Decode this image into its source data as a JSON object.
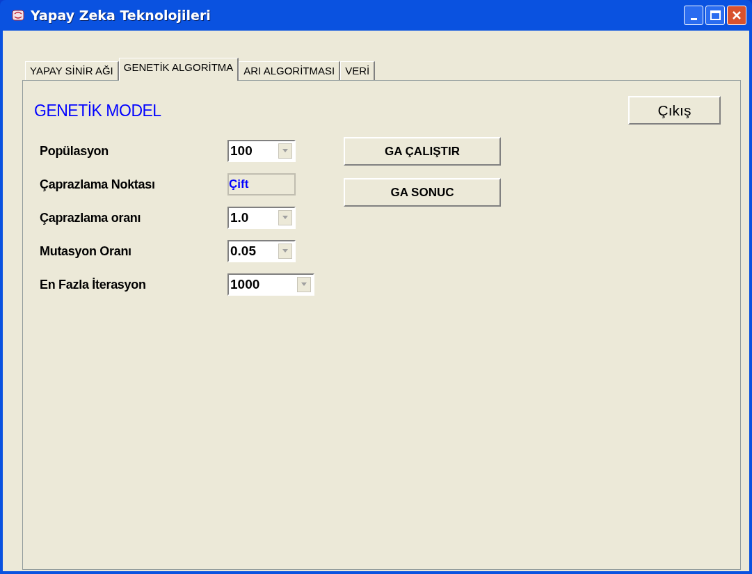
{
  "window": {
    "title": "Yapay Zeka Teknolojileri"
  },
  "tabs": [
    {
      "label": "YAPAY SİNİR AĞI",
      "selected": false
    },
    {
      "label": "GENETİK ALGORİTMA",
      "selected": true
    },
    {
      "label": "ARI ALGORİTMASI",
      "selected": false
    },
    {
      "label": "VERİ",
      "selected": false
    }
  ],
  "heading": "GENETİK MODEL",
  "exit_button": "Çıkış",
  "fields": [
    {
      "label": "Popülasyon",
      "kind": "combo",
      "value": "100"
    },
    {
      "label": "Çaprazlama Noktası",
      "kind": "readonly",
      "value": "Çift"
    },
    {
      "label": "Çaprazlama oranı",
      "kind": "combo",
      "value": "1.0"
    },
    {
      "label": "Mutasyon Oranı",
      "kind": "combo",
      "value": "0.05"
    },
    {
      "label": "En Fazla İterasyon",
      "kind": "wide_combo",
      "value": "1000"
    }
  ],
  "buttons": [
    "GA ÇALIŞTIR",
    "GA SONUC"
  ]
}
